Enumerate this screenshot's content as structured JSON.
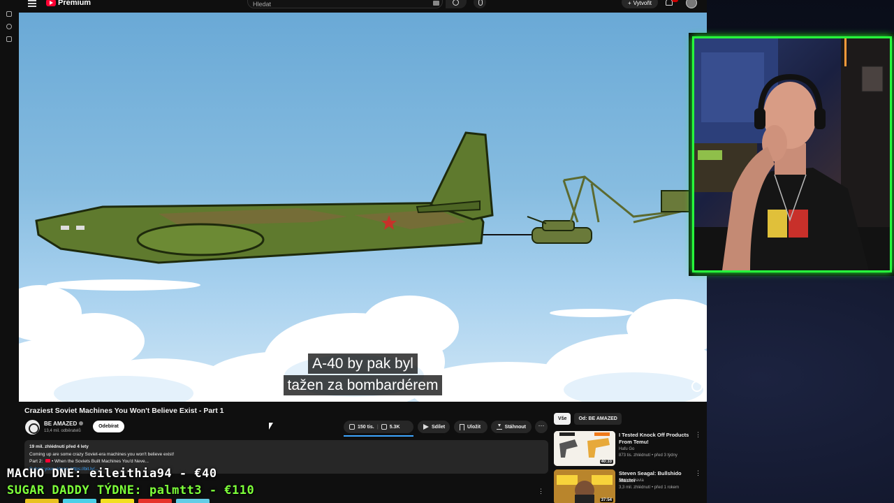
{
  "header": {
    "logo_text": "Premium",
    "search_placeholder": "Hledat",
    "create_label": "Vytvořit",
    "notification_count": "9+"
  },
  "video": {
    "subtitle_line1": "A-40 by pak byl",
    "subtitle_line2": "tažen za bombardérem",
    "title": "Craziest Soviet Machines You Won't Believe Exist - Part 1"
  },
  "channel": {
    "name": "BE AMAZED",
    "subscribers": "13,4 mil. odběratelů",
    "subscribe_label": "Odebírat"
  },
  "actions": {
    "likes": "150 tis.",
    "dislikes": "5.3K",
    "share": "Sdílet",
    "save": "Uložit",
    "download": "Stáhnout",
    "more": "···"
  },
  "description": {
    "stats": "19 mil. zhlédnutí  před 4 lety",
    "line1": "Coming up are some crazy Soviet-era machines you won't believe exist!",
    "line2_prefix": "Part 2:",
    "line2_link": "• When the Soviets Built Machines You'd Neve...",
    "line3": "Submit your videos: https://bit.ly/..."
  },
  "sidebar": {
    "chips": [
      "Vše",
      "Od: BE AMAZED"
    ],
    "recommendations": [
      {
        "title": "I Tested Knock Off Products From Temu!",
        "channel": "Hafu Go",
        "meta": "873 tis. zhlédnutí • před 3 týdny",
        "duration": "40:33",
        "thumb_color": "#f4f1ea"
      },
      {
        "title": "Steven Seagal: Bullshido Master",
        "channel": "Patrick Gavia",
        "meta": "3,3 mil. zhlédnutí • před 1 rokem",
        "duration": "37:54",
        "thumb_color": "#d8a23a"
      }
    ]
  },
  "overlay": {
    "line1": "MACHO DNE: eileithia94 - €40",
    "line2": "SUGAR DADDY TÝDNE: palmtt3 - €110"
  },
  "colors": {
    "accent_green": "#27ff3c",
    "youtube_red": "#ff0033",
    "link_blue": "#3ea6ff"
  }
}
